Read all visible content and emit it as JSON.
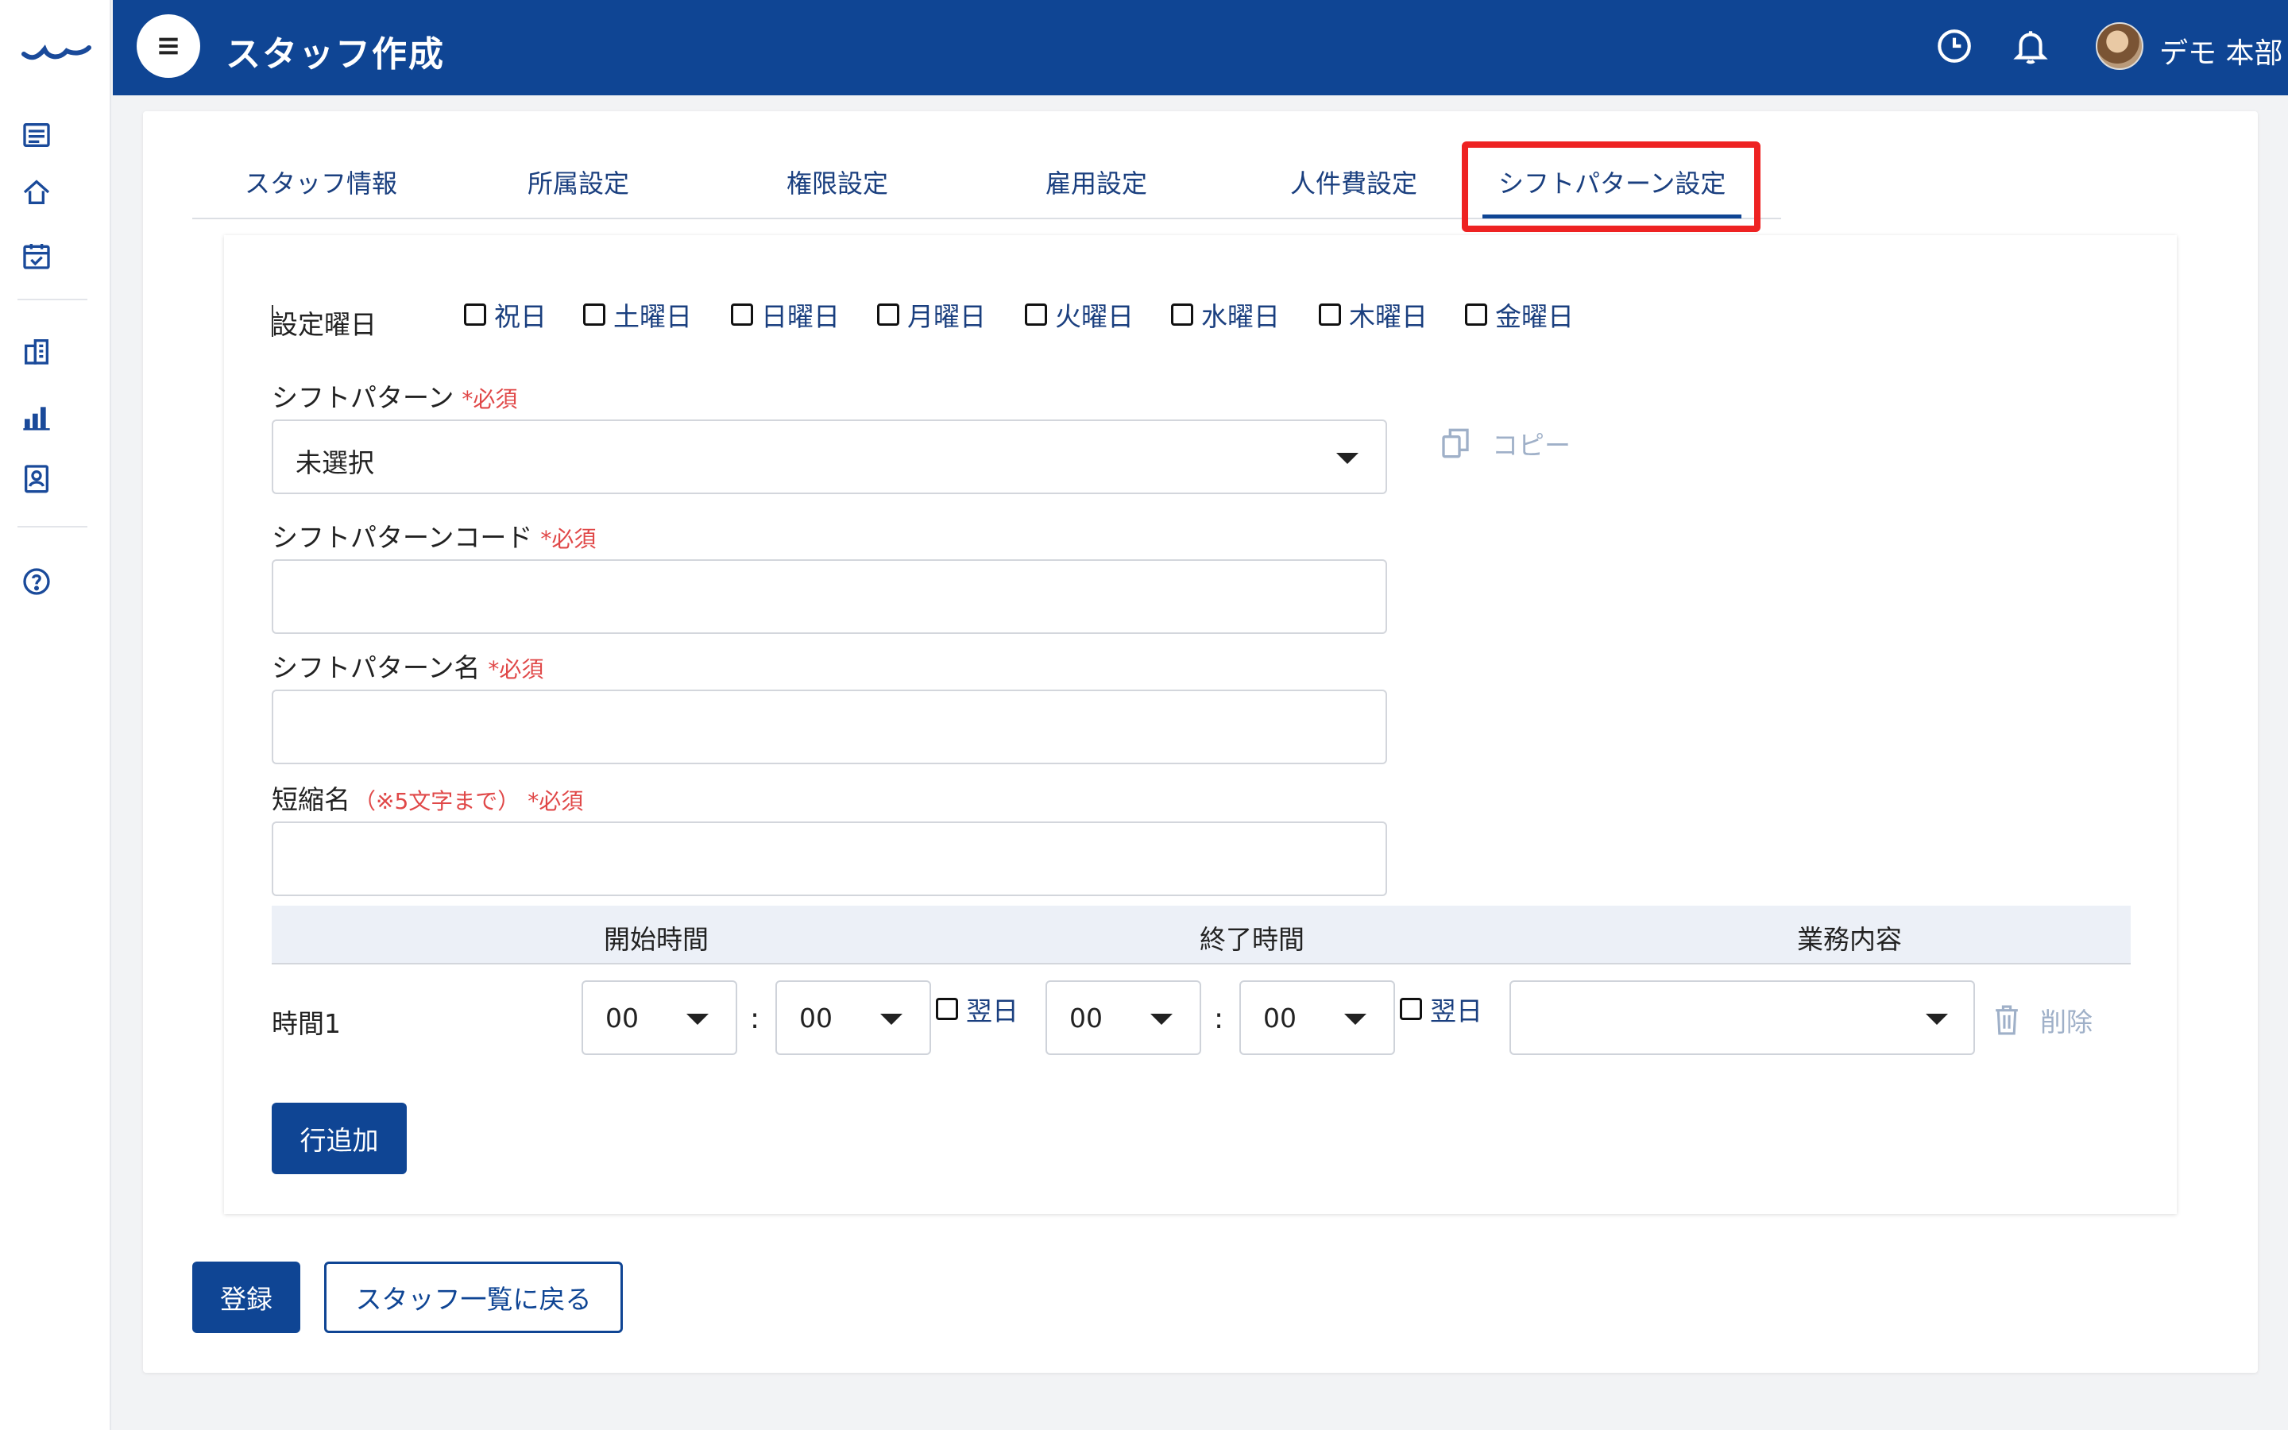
{
  "header": {
    "title": "スタッフ作成",
    "user_name": "デモ 本部"
  },
  "tabs": [
    {
      "label": "スタッフ情報"
    },
    {
      "label": "所属設定"
    },
    {
      "label": "権限設定"
    },
    {
      "label": "雇用設定"
    },
    {
      "label": "人件費設定"
    },
    {
      "label": "シフトパターン設定",
      "active": true
    }
  ],
  "form": {
    "days_label": "設定曜日",
    "days": [
      "祝日",
      "土曜日",
      "日曜日",
      "月曜日",
      "火曜日",
      "水曜日",
      "木曜日",
      "金曜日"
    ],
    "pattern_label": "シフトパターン",
    "pattern_required": "*必須",
    "pattern_value": "未選択",
    "copy_label": "コピー",
    "code_label": "シフトパターンコード",
    "code_required": "*必須",
    "code_value": "",
    "name_label": "シフトパターン名",
    "name_required": "*必須",
    "name_value": "",
    "short_label": "短縮名",
    "short_note": "（※5文字まで）",
    "short_required": "*必須",
    "short_value": ""
  },
  "time_table": {
    "headers": [
      "開始時間",
      "終了時間",
      "業務内容"
    ],
    "rows": [
      {
        "label": "時間1",
        "start_hour": "00",
        "start_min": "00",
        "start_next_day": "翌日",
        "end_hour": "00",
        "end_min": "00",
        "end_next_day": "翌日",
        "task": "",
        "delete_label": "削除"
      }
    ],
    "add_row_label": "行追加"
  },
  "actions": {
    "register_label": "登録",
    "back_label": "スタッフ一覧に戻る"
  },
  "colors": {
    "primary": "#0f4594",
    "required": "#e04848",
    "highlight": "#ee2222"
  }
}
